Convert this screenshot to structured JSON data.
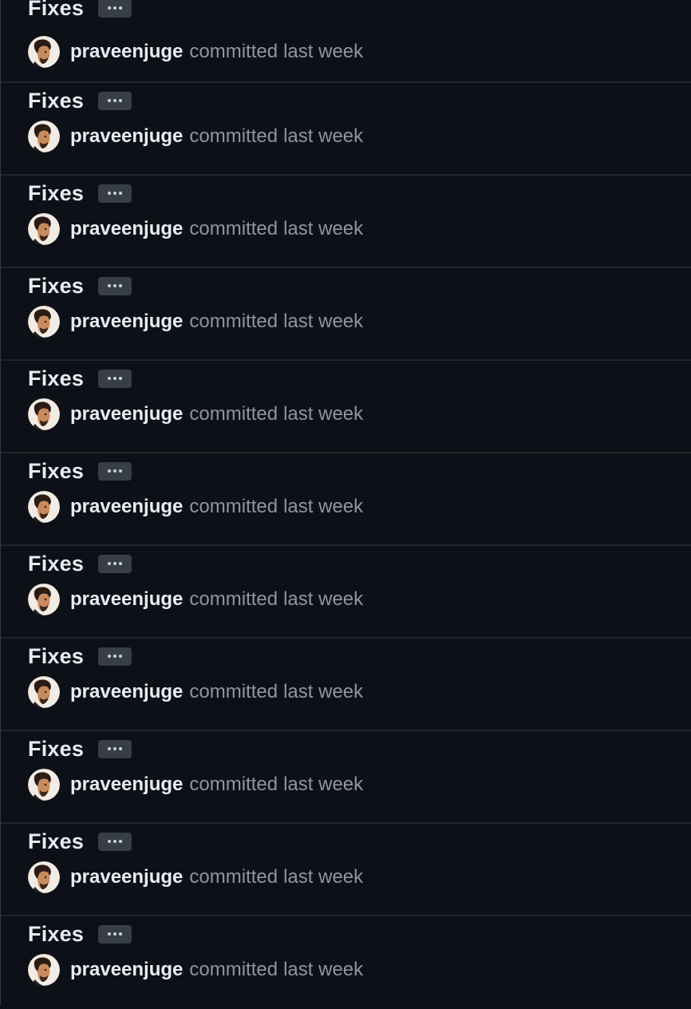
{
  "commits": [
    {
      "title": "Fixes",
      "author": "praveenjuge",
      "action": "committed",
      "when": "last week"
    },
    {
      "title": "Fixes",
      "author": "praveenjuge",
      "action": "committed",
      "when": "last week"
    },
    {
      "title": "Fixes",
      "author": "praveenjuge",
      "action": "committed",
      "when": "last week"
    },
    {
      "title": "Fixes",
      "author": "praveenjuge",
      "action": "committed",
      "when": "last week"
    },
    {
      "title": "Fixes",
      "author": "praveenjuge",
      "action": "committed",
      "when": "last week"
    },
    {
      "title": "Fixes",
      "author": "praveenjuge",
      "action": "committed",
      "when": "last week"
    },
    {
      "title": "Fixes",
      "author": "praveenjuge",
      "action": "committed",
      "when": "last week"
    },
    {
      "title": "Fixes",
      "author": "praveenjuge",
      "action": "committed",
      "when": "last week"
    },
    {
      "title": "Fixes",
      "author": "praveenjuge",
      "action": "committed",
      "when": "last week"
    },
    {
      "title": "Fixes",
      "author": "praveenjuge",
      "action": "committed",
      "when": "last week"
    },
    {
      "title": "Fixes",
      "author": "praveenjuge",
      "action": "committed",
      "when": "last week"
    }
  ],
  "icons": {
    "ellipsis": "kebab-horizontal-icon",
    "avatar": "user-avatar"
  },
  "colors": {
    "background": "#0d1117",
    "divider": "#21262d",
    "title": "#e6edf3",
    "muted": "#8d96a0",
    "ellipsis_bg": "#373e47"
  }
}
